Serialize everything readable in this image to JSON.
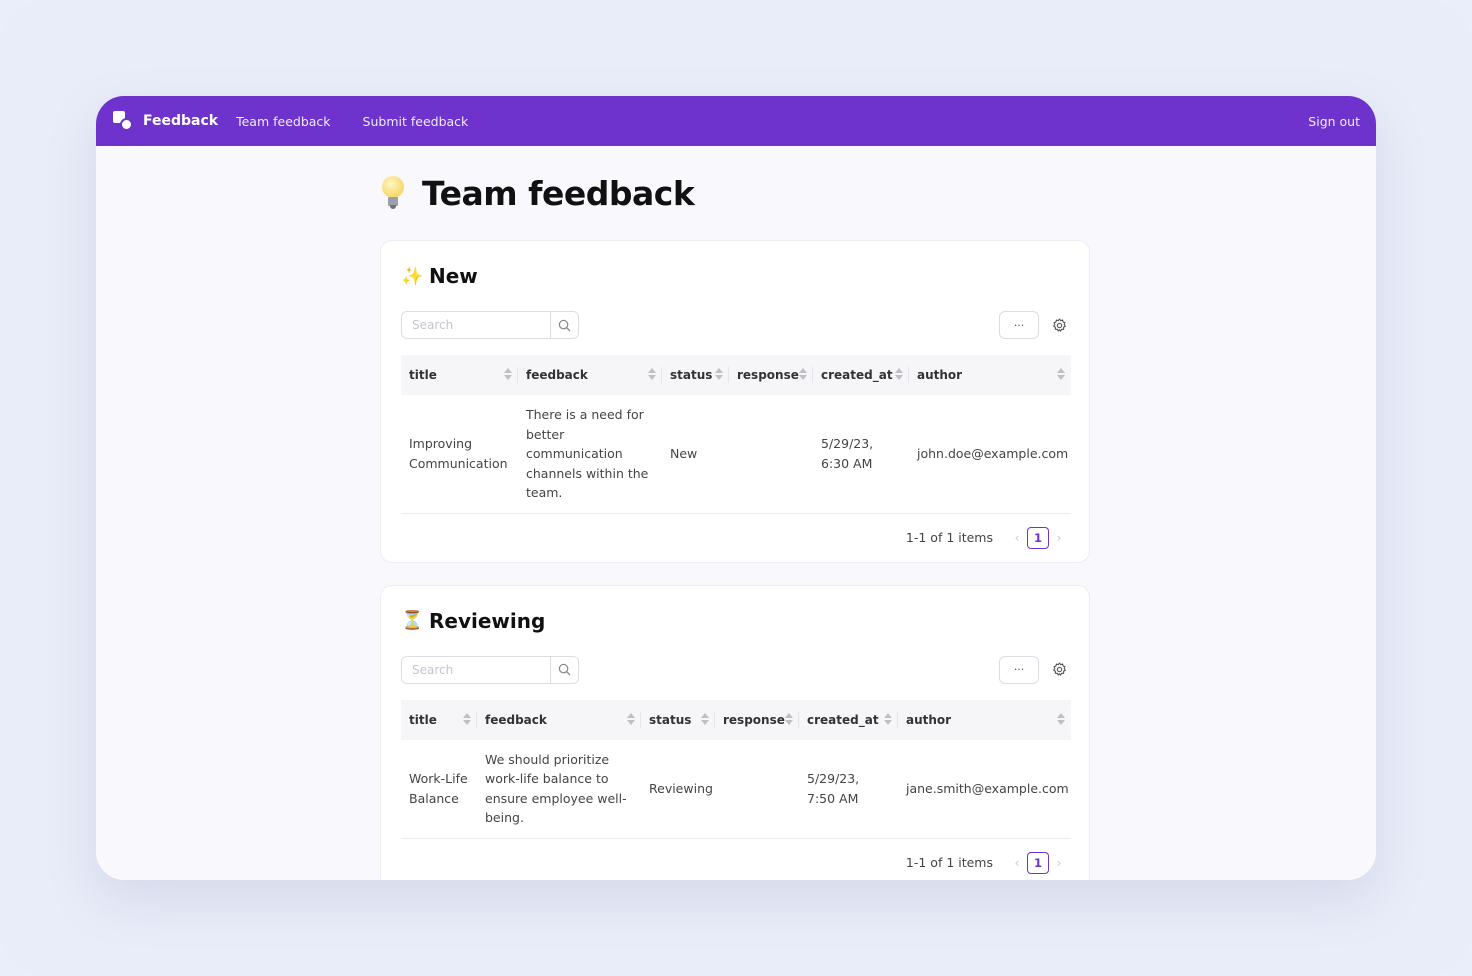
{
  "nav": {
    "brand": "Feedback",
    "links": [
      "Team feedback",
      "Submit feedback"
    ],
    "signout": "Sign out"
  },
  "page": {
    "title": "Team feedback"
  },
  "sections": [
    {
      "emoji": "✨",
      "title": "New",
      "search_placeholder": "Search",
      "more_label": "···",
      "columns": [
        "title",
        "feedback",
        "status",
        "response",
        "created_at",
        "author"
      ],
      "rows": [
        {
          "title": "Improving Communication",
          "feedback": "There is a need for better communication channels within the team.",
          "status": "New",
          "response": "",
          "created_at": "5/29/23, 6:30 AM",
          "author": "john.doe@example.com"
        }
      ],
      "pager_info": "1-1 of 1 items",
      "page": "1"
    },
    {
      "emoji": "⏳",
      "title": "Reviewing",
      "search_placeholder": "Search",
      "more_label": "···",
      "columns": [
        "title",
        "feedback",
        "status",
        "response",
        "created_at",
        "author"
      ],
      "rows": [
        {
          "title": "Work-Life Balance",
          "feedback": "We should prioritize work-life balance to ensure employee well-being.",
          "status": "Reviewing",
          "response": "",
          "created_at": "5/29/23, 7:50 AM",
          "author": "jane.smith@example.com"
        }
      ],
      "pager_info": "1-1 of 1 items",
      "page": "1"
    }
  ]
}
